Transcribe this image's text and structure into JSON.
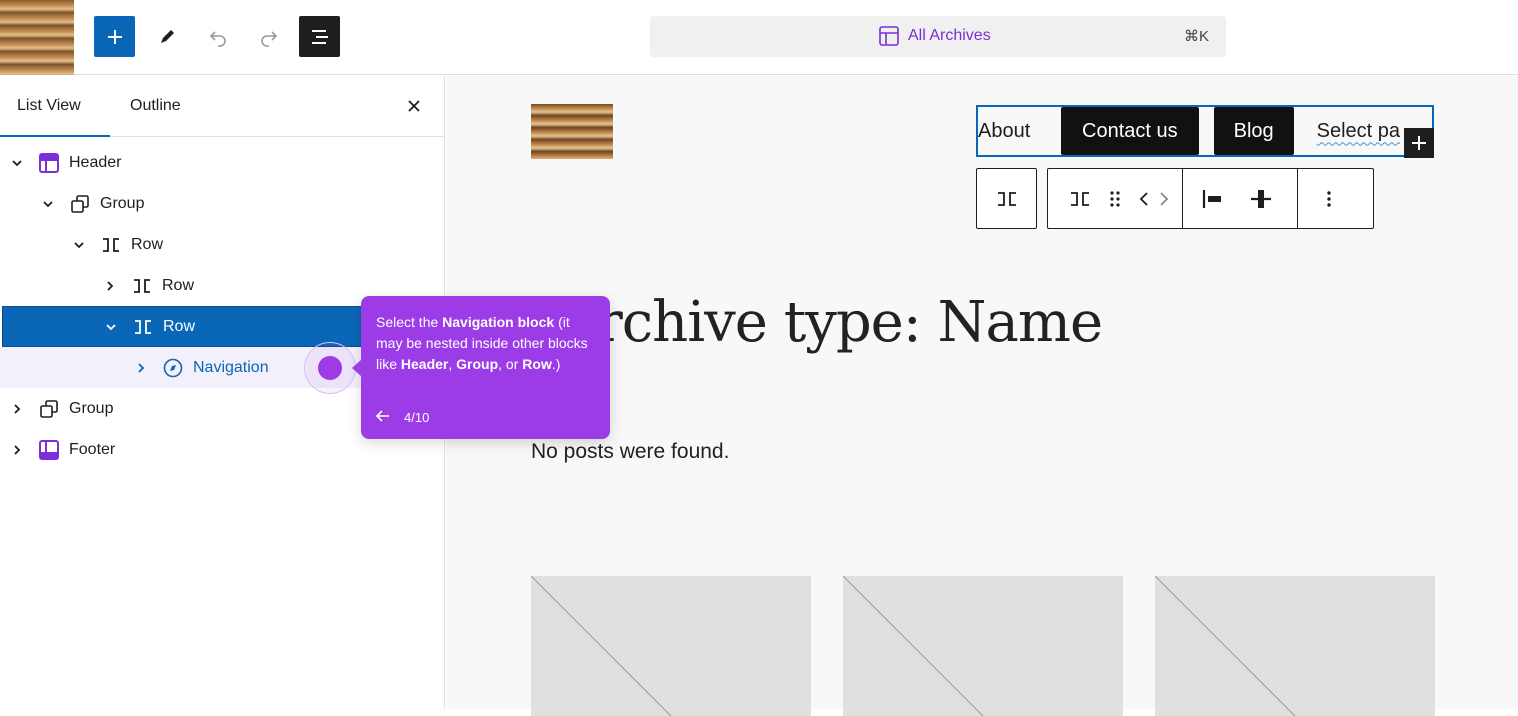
{
  "toolbar": {
    "add_label": "+",
    "command": {
      "label": "All Archives",
      "shortcut": "⌘K"
    }
  },
  "panel": {
    "tabs": [
      "List View",
      "Outline"
    ],
    "tree": [
      {
        "label": "Header",
        "icon": "template-part-icon",
        "expanded": true
      },
      {
        "label": "Group",
        "icon": "group-icon",
        "expanded": true
      },
      {
        "label": "Row",
        "icon": "row-icon",
        "expanded": true
      },
      {
        "label": "Row",
        "icon": "row-icon",
        "expanded": false
      },
      {
        "label": "Row",
        "icon": "row-icon",
        "expanded": true,
        "selected": true
      },
      {
        "label": "Navigation",
        "icon": "compass-icon",
        "expanded": false
      },
      {
        "label": "Group",
        "icon": "group-icon",
        "expanded": false
      },
      {
        "label": "Footer",
        "icon": "template-part-icon",
        "expanded": false
      }
    ]
  },
  "canvas": {
    "nav_items": [
      "About",
      "Contact us",
      "Blog",
      "Select pa"
    ],
    "heading": "rchive type: Name",
    "no_posts": "No posts were found."
  },
  "tooltip": {
    "text_1": "Select the ",
    "bold_1": "Navigation block",
    "text_2": " (it may be nested inside other blocks like ",
    "bold_2": "Header",
    "text_3": ", ",
    "bold_3": "Group",
    "text_4": ", or ",
    "bold_4": "Row",
    "text_5": ".)",
    "step": "4/10"
  },
  "colors": {
    "accent": "#0a66b7",
    "tour": "#9b3ce6",
    "template_part": "#7b2fd6"
  }
}
